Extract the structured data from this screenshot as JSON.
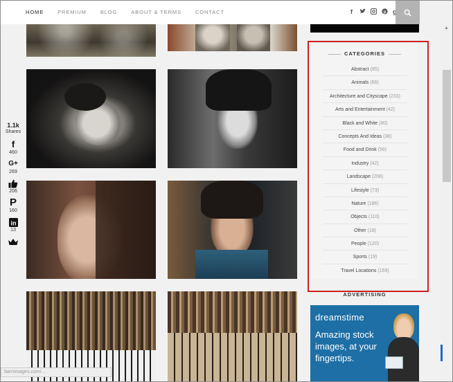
{
  "nav": {
    "items": [
      "HOME",
      "PREMIUM",
      "BLOG",
      "ABOUT & TERMS",
      "CONTACT"
    ],
    "social_icons": [
      "facebook-icon",
      "twitter-icon",
      "instagram-icon",
      "pinterest-icon",
      "google-plus-icon"
    ],
    "search_icon": "search-icon"
  },
  "share": {
    "total": "1.1k",
    "label": "Shares",
    "facebook": "460",
    "googleplus": "269",
    "like": "206",
    "pinterest": "160",
    "linkedin": "13"
  },
  "categories": {
    "title": "CATEGORIES",
    "items": [
      {
        "name": "Abstract",
        "count": "(85)"
      },
      {
        "name": "Animals",
        "count": "(66)"
      },
      {
        "name": "Architecture and Cityscape",
        "count": "(233)"
      },
      {
        "name": "Arts and Entertainment",
        "count": "(42)"
      },
      {
        "name": "Black and White",
        "count": "(80)"
      },
      {
        "name": "Concepts And Ideas",
        "count": "(38)"
      },
      {
        "name": "Food and Drink",
        "count": "(56)"
      },
      {
        "name": "Industry",
        "count": "(42)"
      },
      {
        "name": "Landscape",
        "count": "(208)"
      },
      {
        "name": "Lifestyle",
        "count": "(73)"
      },
      {
        "name": "Nature",
        "count": "(186)"
      },
      {
        "name": "Objects",
        "count": "(110)"
      },
      {
        "name": "Other",
        "count": "(18)"
      },
      {
        "name": "People",
        "count": "(120)"
      },
      {
        "name": "Sports",
        "count": "(19)"
      },
      {
        "name": "Travel Locations",
        "count": "(169)"
      }
    ]
  },
  "advertising": {
    "title": "ADVERTISING",
    "brand": "dreamstime",
    "text": "Amazing stock images, at your fingertips."
  },
  "status_bar": "barnimages.com/..."
}
